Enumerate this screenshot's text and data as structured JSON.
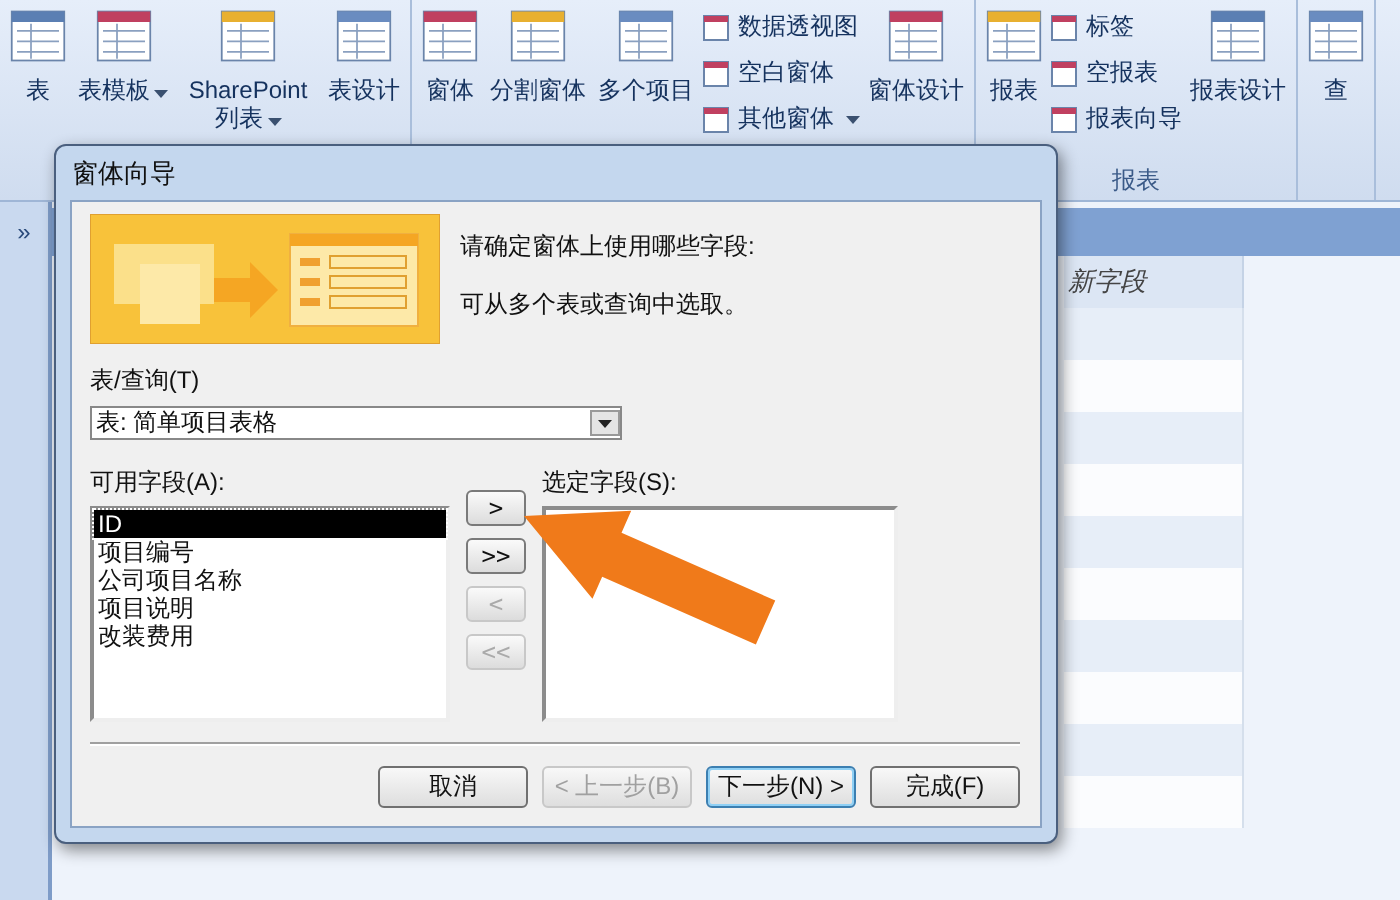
{
  "ribbon": {
    "groups": [
      {
        "items": [
          {
            "kind": "large",
            "label": "表",
            "dropdown": false
          },
          {
            "kind": "large",
            "label": "表模板",
            "dropdown": true
          },
          {
            "kind": "large",
            "label": "SharePoint 列表",
            "dropdown": true
          },
          {
            "kind": "large",
            "label": "表设计",
            "dropdown": false
          }
        ]
      },
      {
        "items": [
          {
            "kind": "large",
            "label": "窗体",
            "dropdown": false
          },
          {
            "kind": "large",
            "label": "分割窗体",
            "dropdown": false
          },
          {
            "kind": "large",
            "label": "多个项目",
            "dropdown": false
          },
          {
            "kind": "small",
            "labels": [
              {
                "label": "数据透视图",
                "dropdown": false
              },
              {
                "label": "空白窗体",
                "dropdown": false
              },
              {
                "label": "其他窗体",
                "dropdown": true
              }
            ]
          },
          {
            "kind": "large",
            "label": "窗体设计",
            "dropdown": false
          }
        ]
      },
      {
        "title": "报表",
        "items": [
          {
            "kind": "large",
            "label": "报表",
            "dropdown": false
          },
          {
            "kind": "small",
            "labels": [
              {
                "label": "标签",
                "dropdown": false
              },
              {
                "label": "空报表",
                "dropdown": false
              },
              {
                "label": "报表向导",
                "dropdown": false
              }
            ]
          },
          {
            "kind": "large",
            "label": "报表设计",
            "dropdown": false
          }
        ]
      },
      {
        "items": [
          {
            "kind": "large",
            "label": "查",
            "dropdown": false
          }
        ]
      }
    ]
  },
  "nav_pane": {
    "toggle": "»"
  },
  "table": {
    "column_header": "新字段"
  },
  "dialog": {
    "title": "窗体向导",
    "intro": [
      "请确定窗体上使用哪些字段:",
      "可从多个表或查询中选取。"
    ],
    "table_query_label": "表/查询(T)",
    "table_query_value": "表: 简单项目表格",
    "available_label": "可用字段(A):",
    "available_fields": [
      {
        "label": "ID",
        "selected": true
      },
      {
        "label": "项目编号",
        "selected": false
      },
      {
        "label": "公司项目名称",
        "selected": false
      },
      {
        "label": "项目说明",
        "selected": false
      },
      {
        "label": "改装费用",
        "selected": false
      }
    ],
    "selected_label": "选定字段(S):",
    "move_buttons": [
      {
        "label": ">",
        "disabled": false
      },
      {
        "label": ">>",
        "disabled": false
      },
      {
        "label": "<",
        "disabled": true
      },
      {
        "label": "<<",
        "disabled": true
      }
    ],
    "buttons": [
      {
        "label": "取消",
        "disabled": false,
        "default": false
      },
      {
        "label": "< 上一步(B)",
        "disabled": true,
        "default": false
      },
      {
        "label": "下一步(N) >",
        "disabled": false,
        "default": true
      },
      {
        "label": "完成(F)",
        "disabled": false,
        "default": false
      }
    ]
  }
}
